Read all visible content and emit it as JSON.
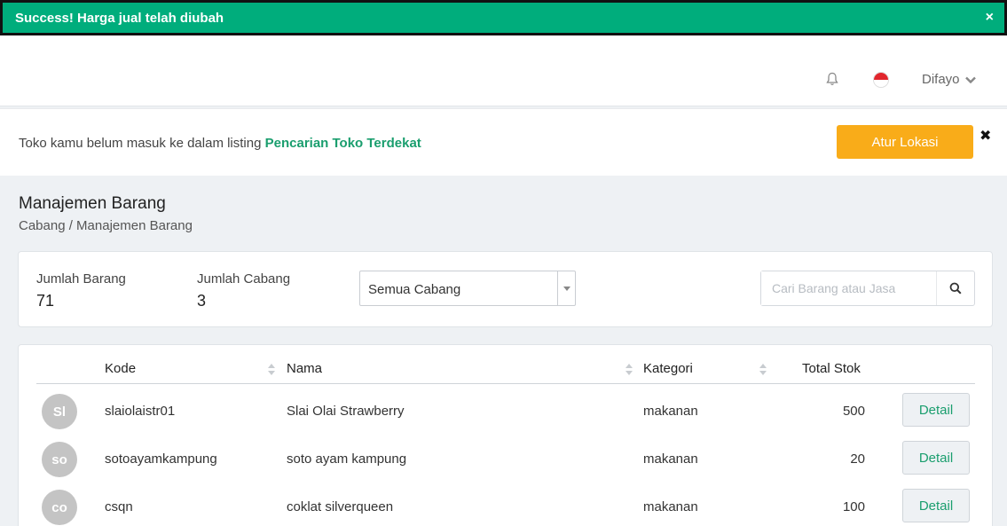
{
  "toast": {
    "message": "Success! Harga jual telah diubah",
    "close": "×"
  },
  "topbar": {
    "user_name": "Difayo"
  },
  "banner": {
    "text": "Toko kamu belum masuk ke dalam listing ",
    "link": "Pencarian Toko Terdekat",
    "button": "Atur Lokasi",
    "close": "✖"
  },
  "page": {
    "title": "Manajemen Barang",
    "breadcrumb": "Cabang / Manajemen Barang"
  },
  "stats": {
    "jumlah_barang_label": "Jumlah Barang",
    "jumlah_barang_value": "71",
    "jumlah_cabang_label": "Jumlah Cabang",
    "jumlah_cabang_value": "3",
    "branch_select_value": "Semua Cabang",
    "search_placeholder": "Cari Barang atau Jasa"
  },
  "table": {
    "headers": {
      "kode": "Kode",
      "nama": "Nama",
      "kategori": "Kategori",
      "stok": "Total Stok"
    },
    "rows": [
      {
        "initials": "Sl",
        "kode": "slaiolaistr01",
        "nama": "Slai Olai Strawberry",
        "kategori": "makanan",
        "stok": "500",
        "action": "Detail"
      },
      {
        "initials": "so",
        "kode": "sotoayamkampung",
        "nama": "soto ayam kampung",
        "kategori": "makanan",
        "stok": "20",
        "action": "Detail"
      },
      {
        "initials": "co",
        "kode": "csqn",
        "nama": "coklat silverqueen",
        "kategori": "makanan",
        "stok": "100",
        "action": "Detail"
      }
    ]
  },
  "colors": {
    "success": "#00ad7c",
    "accent": "#1a9e6e",
    "warning": "#f9ac19"
  },
  "icons": {
    "bell": "bell-icon",
    "flag": "indonesia-flag-icon",
    "chevron": "chevron-down-icon",
    "search": "search-icon",
    "sort": "sort-icon"
  }
}
